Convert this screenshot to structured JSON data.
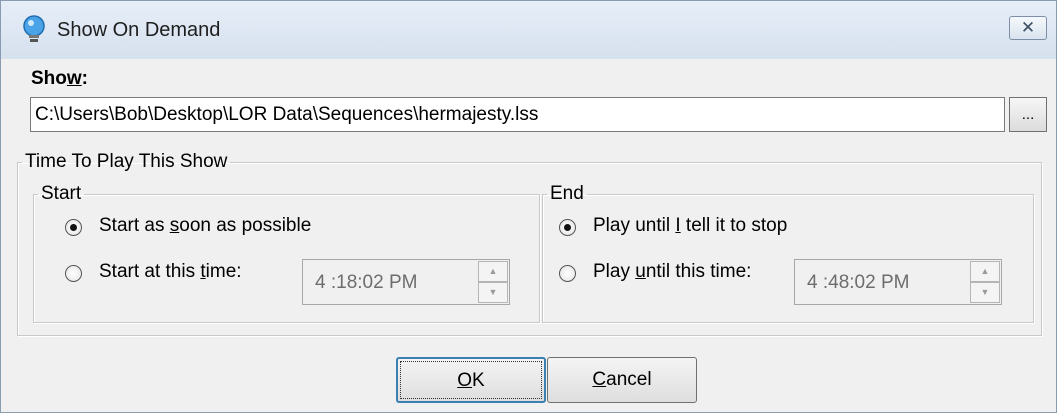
{
  "window": {
    "title": "Show On Demand",
    "close_label": "✕"
  },
  "show": {
    "label_pre": "Sho",
    "label_mnemonic": "w",
    "label_post": ":",
    "path": "C:\\Users\\Bob\\Desktop\\LOR Data\\Sequences\\hermajesty.lss",
    "browse_label": "..."
  },
  "time_group": {
    "legend": "Time To Play This Show",
    "start": {
      "legend": "Start",
      "option_asap": {
        "pre": "Start as ",
        "mnemonic": "s",
        "post": "oon as possible",
        "selected": true
      },
      "option_time": {
        "pre": "Start at this ",
        "mnemonic": "t",
        "post": "ime:",
        "selected": false
      },
      "time_value": "4 :18:02 PM"
    },
    "end": {
      "legend": "End",
      "option_stop": {
        "pre": "Play until ",
        "mnemonic": "I",
        "post": " tell it to stop",
        "selected": true
      },
      "option_time": {
        "pre": "Play ",
        "mnemonic": "u",
        "post": "ntil this time:",
        "selected": false
      },
      "time_value": "4 :48:02 PM"
    }
  },
  "buttons": {
    "ok": {
      "mnemonic": "O",
      "post": "K"
    },
    "cancel": {
      "mnemonic": "C",
      "post": "ancel"
    }
  },
  "icons": {
    "title_icon": "lightbulb-icon",
    "spin_up": "▲",
    "spin_down": "▼"
  },
  "colors": {
    "titlebar": "#dbe5f1",
    "default_button_border": "#3c7fb1"
  }
}
